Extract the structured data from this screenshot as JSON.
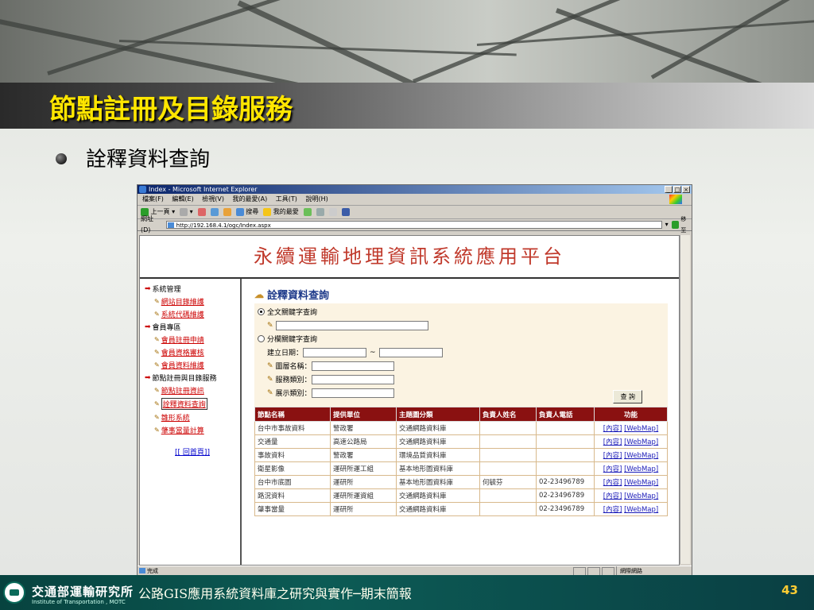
{
  "slide": {
    "title": "節點註冊及目錄服務",
    "bullet": "詮釋資料查詢",
    "footer_org_zh": "交通部運輸研究所",
    "footer_org_en": "Institute of Transportation , MOTC",
    "footer_title": "公路GIS應用系統資料庫之研究與實作─期末簡報",
    "page_number": "43"
  },
  "browser": {
    "title": "Index - Microsoft Internet Explorer",
    "menu": [
      "檔案(F)",
      "編輯(E)",
      "檢視(V)",
      "我的最愛(A)",
      "工具(T)",
      "說明(H)"
    ],
    "toolbar": {
      "back": "上一頁",
      "search": "搜尋",
      "favorites": "我的最愛"
    },
    "address_label": "網址(D)",
    "url": "http://192.168.4.1/ogc/Index.aspx",
    "go_label": "移至",
    "status_text": "完成",
    "zone_text": "網際網路"
  },
  "site": {
    "banner": "永續運輸地理資訊系統應用平台",
    "nav": [
      {
        "type": "section",
        "label": "系統管理"
      },
      {
        "type": "link",
        "label": "網站目錄維護"
      },
      {
        "type": "link",
        "label": "系統代碼維護"
      },
      {
        "type": "section",
        "label": "會員專區"
      },
      {
        "type": "link",
        "label": "會員註冊申請"
      },
      {
        "type": "link",
        "label": "會員資格審核"
      },
      {
        "type": "link",
        "label": "會員資料維護"
      },
      {
        "type": "section",
        "label": "節點註冊與目錄服務"
      },
      {
        "type": "link",
        "label": "節點註冊資訊"
      },
      {
        "type": "link",
        "label": "詮釋資料查詢",
        "active": true
      },
      {
        "type": "link",
        "label": "雛形系統"
      },
      {
        "type": "link",
        "label": "肇事當量計算"
      }
    ],
    "home_link": "[[ 回首頁]]"
  },
  "query": {
    "title": "詮釋資料查詢",
    "opt_fulltext": "全文關鍵字查詢",
    "opt_field": "分欄關鍵字查詢",
    "date_label": "建立日期：",
    "date_sep": "~",
    "layer_label": "圖層名稱：",
    "service_label": "服務類別：",
    "display_label": "展示類別：",
    "submit_label": "查 詢"
  },
  "results": {
    "headers": [
      "節點名稱",
      "提供單位",
      "主題圖分類",
      "負責人姓名",
      "負責人電話",
      "功能"
    ],
    "rows": [
      [
        "台中市事故資料",
        "警政署",
        "交通網路資料庫",
        "",
        ""
      ],
      [
        "交通量",
        "高速公路局",
        "交通網路資料庫",
        "",
        ""
      ],
      [
        "事故資料",
        "警政署",
        "環境品質資料庫",
        "",
        ""
      ],
      [
        "衛星影像",
        "運研所運工組",
        "基本地形圖資料庫",
        "",
        ""
      ],
      [
        "台中市底圖",
        "運研所",
        "基本地形圖資料庫",
        "何毓芬",
        "02-23496789"
      ],
      [
        "路況資料",
        "運研所運資組",
        "交通網路資料庫",
        "",
        "02-23496789"
      ],
      [
        "肇事當量",
        "運研所",
        "交通網路資料庫",
        "",
        "02-23496789"
      ]
    ],
    "link_content": "[內容]",
    "link_webmap": "[WebMap]"
  }
}
